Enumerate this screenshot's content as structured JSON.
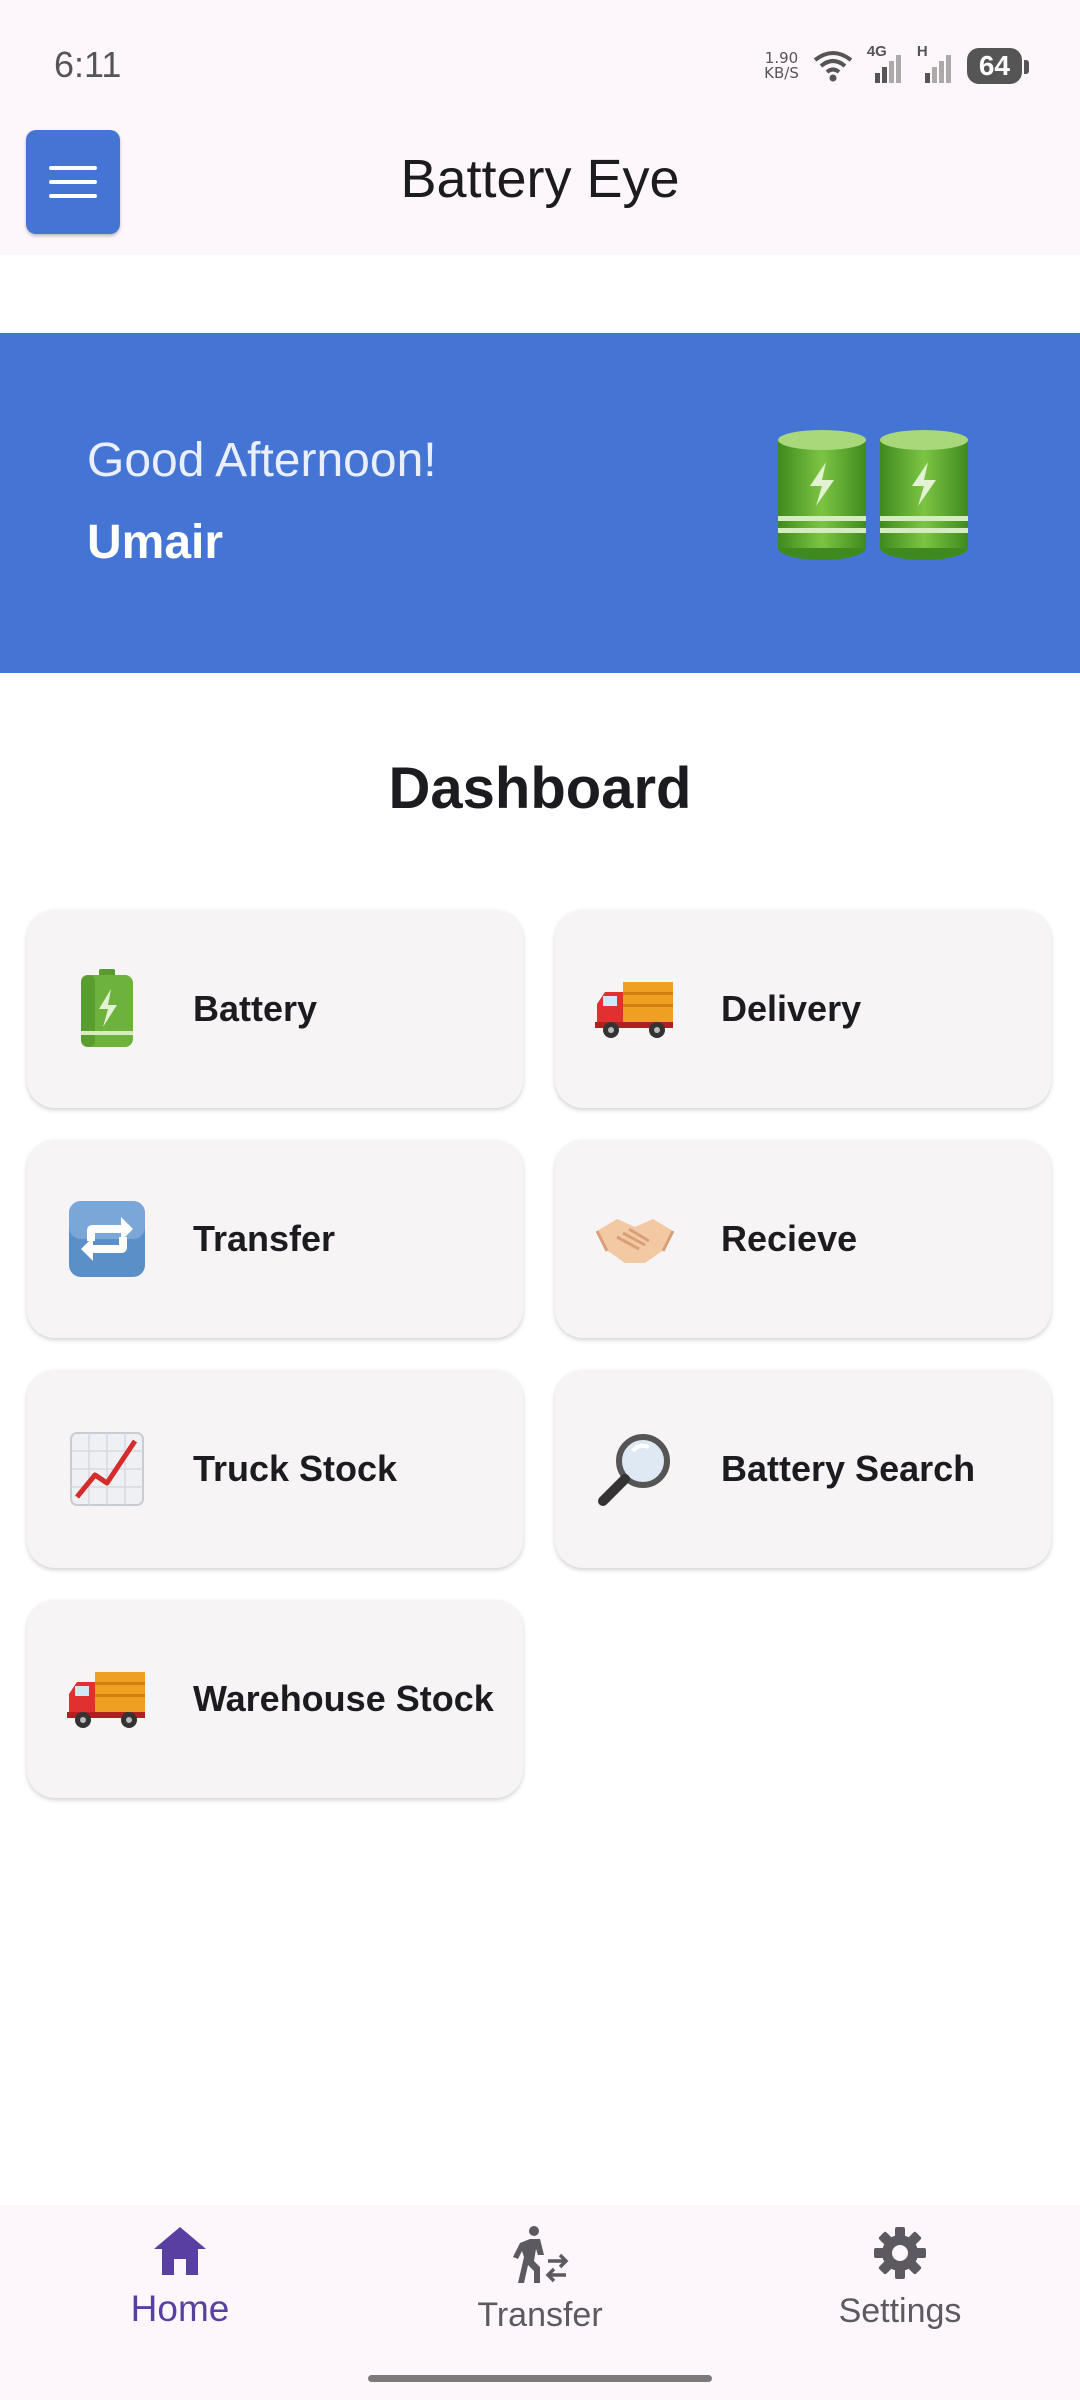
{
  "status_bar": {
    "time": "6:11",
    "net_speed_value": "1.90",
    "net_speed_unit": "KB/S",
    "signal1": "4G",
    "signal2": "H",
    "battery": "64"
  },
  "app_bar": {
    "title": "Battery Eye"
  },
  "banner": {
    "greeting": "Good Afternoon!",
    "username": "Umair"
  },
  "dashboard": {
    "title": "Dashboard",
    "cards": [
      {
        "label": "Battery",
        "icon": "battery-icon"
      },
      {
        "label": "Delivery",
        "icon": "delivery-truck-icon"
      },
      {
        "label": "Transfer",
        "icon": "transfer-arrows-icon"
      },
      {
        "label": "Recieve",
        "icon": "handshake-icon"
      },
      {
        "label": "Truck Stock",
        "icon": "chart-increasing-icon"
      },
      {
        "label": "Battery Search",
        "icon": "magnifier-icon"
      },
      {
        "label": "Warehouse Stock",
        "icon": "delivery-truck-icon"
      }
    ]
  },
  "bottom_nav": {
    "items": [
      {
        "label": "Home",
        "icon": "home-icon",
        "active": true
      },
      {
        "label": "Transfer",
        "icon": "person-transfer-icon",
        "active": false
      },
      {
        "label": "Settings",
        "icon": "gear-icon",
        "active": false
      }
    ]
  },
  "colors": {
    "primary": "#4474d4",
    "nav_active": "#5a3fa3",
    "card_bg": "#f7f4f6"
  }
}
